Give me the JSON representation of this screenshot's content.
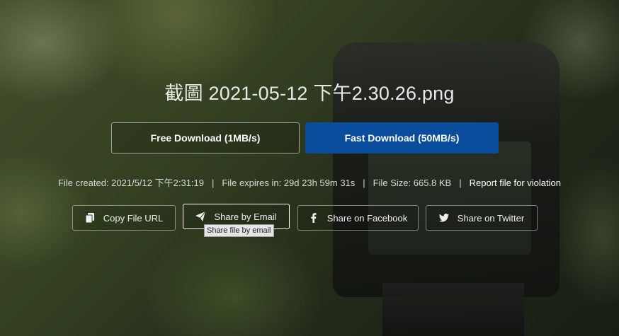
{
  "file": {
    "title": "截圖 2021-05-12 下午2.30.26.png"
  },
  "buttons": {
    "free_download": "Free Download (1MB/s)",
    "fast_download": "Fast Download (50MB/s)",
    "fast_color": "#0a4d9c"
  },
  "info": {
    "created": "File created: 2021/5/12 下午2:31:19",
    "expires": "File expires in: 29d 23h 59m 31s",
    "size": "File Size: 665.8 KB",
    "separator": "|",
    "report": "Report file for violation"
  },
  "share": {
    "copy_url": "Copy File URL",
    "email": "Share by Email",
    "facebook": "Share on Facebook",
    "twitter": "Share on Twitter",
    "email_tooltip": "Share file by email"
  },
  "icons": {
    "copy": "copy-icon",
    "email": "paper-plane-icon",
    "facebook": "facebook-icon",
    "twitter": "twitter-icon"
  }
}
